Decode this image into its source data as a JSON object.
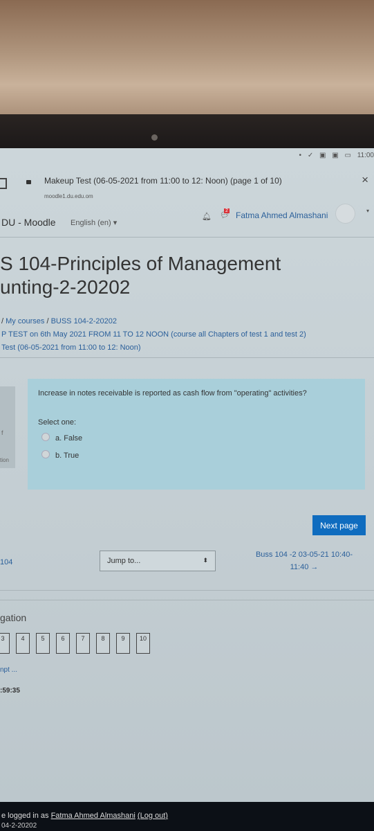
{
  "status_bar": {
    "icons": [
      "dot-icon",
      "check-icon",
      "image-icon",
      "image-icon",
      "keyboard-icon"
    ],
    "time": "11:00"
  },
  "browser": {
    "title": "Makeup Test (06-05-2021 from 11:00 to 12: Noon) (page 1 of 10)",
    "url": "moodle1.du.edu.om",
    "close": "×"
  },
  "navbar": {
    "brand": "DU - Moodle",
    "language": "English (en)",
    "message_count": "2",
    "user_name": "Fatma Ahmed Almashani"
  },
  "page": {
    "heading_line1": "S 104-Principles of Management",
    "heading_line2": "unting-2-20202",
    "breadcrumb": {
      "sep": "/",
      "my_courses": "My courses",
      "course": "BUSS 104-2-20202",
      "section": "P TEST on 6th May 2021 FROM 11 TO 12 NOON (course all Chapters of test 1 and test 2)",
      "quiz": "Test (06-05-2021 from 11:00 to 12: Noon)"
    }
  },
  "question": {
    "side_f": "f",
    "side_tion": "tion",
    "text": "Increase in notes receivable is reported as cash flow from \"operating\" activities?",
    "select_label": "Select one:",
    "options": [
      {
        "label": "a. False",
        "selected": false
      },
      {
        "label": "b. True",
        "selected": false
      }
    ]
  },
  "actions": {
    "next_page": "Next page",
    "prev_link": "104",
    "jump_to": "Jump to...",
    "next_activity_line1": "Buss 104 -2  03-05-21 10:40-",
    "next_activity_line2": "11:40 →"
  },
  "quiz_nav": {
    "heading": "gation",
    "questions": [
      "3",
      "4",
      "5",
      "6",
      "7",
      "8",
      "9",
      "10"
    ],
    "attempt_link": "npt ...",
    "timer": ":59:35"
  },
  "footer": {
    "logged_prefix": "e logged in as",
    "user": "Fatma Ahmed Almashani",
    "logout": "(Log out)",
    "course": "04-2-20202"
  },
  "colors": {
    "primary": "#0f6cbf",
    "link": "#2a5f9a",
    "question_bg": "#a9cfda",
    "footer": "#0c1016"
  }
}
